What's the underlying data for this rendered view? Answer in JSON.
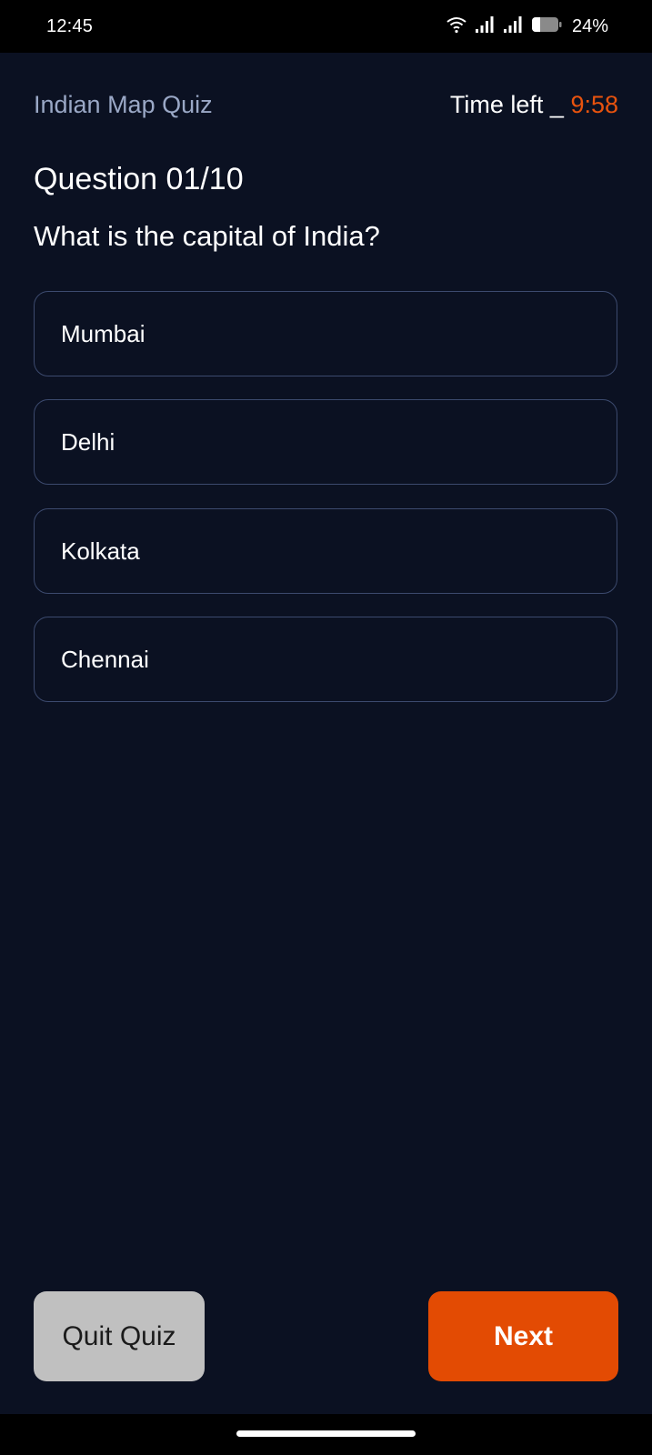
{
  "status_bar": {
    "time": "12:45",
    "battery": "24%",
    "icons": [
      "wifi-icon",
      "signal-icon",
      "signal-icon",
      "battery-icon"
    ]
  },
  "header": {
    "app_title": "Indian Map Quiz",
    "timer_label": "Time left _ ",
    "timer_value": "9:58"
  },
  "question": {
    "number_label": "Question 01/10",
    "text": "What is the capital of India?"
  },
  "options": [
    {
      "label": "Mumbai"
    },
    {
      "label": "Delhi"
    },
    {
      "label": "Kolkata"
    },
    {
      "label": "Chennai"
    }
  ],
  "buttons": {
    "quit_label": "Quit Quiz",
    "next_label": "Next"
  },
  "colors": {
    "background": "#0b1122",
    "accent": "#e34b03",
    "muted_text": "#9aa8c6",
    "option_border": "#3c4a6e"
  }
}
